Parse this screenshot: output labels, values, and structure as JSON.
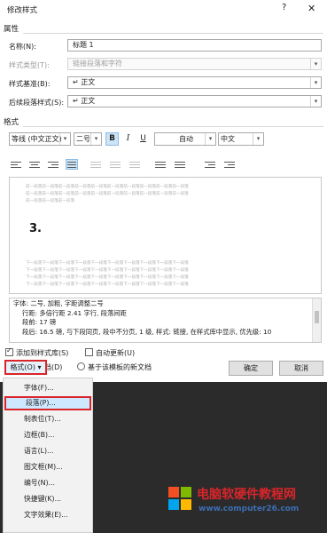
{
  "window": {
    "title": "修改样式",
    "help_icon": "?",
    "close_icon": "✕"
  },
  "properties": {
    "section_title": "属性",
    "name_label": "名称(N):",
    "name_value": "标题 1",
    "type_label": "样式类型(T):",
    "type_value": "链接段落和字符",
    "based_label": "样式基准(B):",
    "based_value": "↵ 正文",
    "next_label": "后续段落样式(S):",
    "next_value": "↵ 正文"
  },
  "format": {
    "section_title": "格式",
    "font_value": "等线 (中文正文)",
    "size_value": "二号",
    "bold": "B",
    "italic": "I",
    "underline": "U",
    "color_value": "自动",
    "lang_value": "中文"
  },
  "preview": {
    "prev_text_1": "前一段落前一段落前一段落前一段落前一段落前一段落前一段落前一段落前一段落前一段落",
    "prev_text_2": "前一段落前一段落前一段落前一段落前一段落前一段落前一段落前一段落前一段落前一段落",
    "prev_text_3": "前一段落前一段落前一段落",
    "sample": "3.",
    "next_text_1": "下一段落下一段落下一段落下一段落下一段落下一段落下一段落下一段落下一段落下一段落",
    "next_text_2": "下一段落下一段落下一段落下一段落下一段落下一段落下一段落下一段落下一段落下一段落",
    "next_text_3": "下一段落下一段落下一段落下一段落下一段落下一段落下一段落下一段落下一段落下一段落",
    "next_text_4": "下一段落下一段落下一段落下一段落下一段落下一段落下一段落下一段落下一段落下一段落"
  },
  "description": {
    "line1": "字体: 二号, 加粗, 字距调整二号",
    "line2": "行距: 多倍行距 2.41 字行, 段落间距",
    "line3": "段前: 17 磅",
    "line4": "段后: 16.5 磅, 与下段同页, 段中不分页, 1 级, 样式: 链接, 在样式库中显示, 优先级: 10"
  },
  "options": {
    "add_gallery": "添加到样式库(S)",
    "auto_update": "自动更新(U)",
    "only_doc": "仅限此文档(D)",
    "new_template": "基于该模板的新文档"
  },
  "buttons": {
    "format": "格式(O) ▾",
    "ok": "确定",
    "cancel": "取消"
  },
  "menu": {
    "items": [
      "字体(F)...",
      "段落(P)...",
      "制表位(T)...",
      "边框(B)...",
      "语言(L)...",
      "图文框(M)...",
      "编号(N)...",
      "快捷键(K)...",
      "文字效果(E)..."
    ]
  },
  "watermark": {
    "title": "电脑软硬件教程网",
    "url": "www.computer26.com"
  },
  "colors": {
    "highlight_red": "#d9252a",
    "selection_blue": "#cce4f7",
    "dark_footer": "#2b2b2b"
  }
}
